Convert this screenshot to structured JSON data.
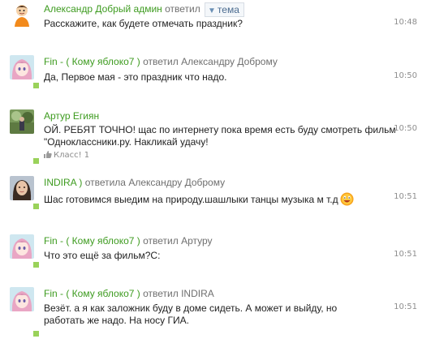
{
  "colors": {
    "author": "#3d9b1f",
    "online": "#9ad25a"
  },
  "tema_button": {
    "label": "тема",
    "icon": "triangle-down-icon"
  },
  "messages": [
    {
      "author": "Александр Добрый админ",
      "reply_prefix": "ответил",
      "reply_to": "",
      "text": "Расскажите, как будете отмечать праздник?",
      "time": "10:48",
      "avatar": "cartoon-avatar-icon",
      "online": false,
      "likes": ""
    },
    {
      "author": "Fin - ( Кому яблоко7 )",
      "reply_prefix": "ответил",
      "reply_to": "Александру Доброму",
      "text": "Да, Первое мая - это праздник что надо.",
      "time": "10:50",
      "avatar": "anime-avatar-icon",
      "online": true,
      "likes": ""
    },
    {
      "author": "Артур Егиян",
      "reply_prefix": "",
      "reply_to": "",
      "text": "ОЙ. РЕБЯТ ТОЧНО! щас по интернету пока время есть буду смотреть фильм \"Одноклассники.ру. Накликай удачу!",
      "time": "10:50",
      "avatar": "photo-avatar-icon",
      "online": true,
      "likes": "Класс! 1"
    },
    {
      "author": "INDIRA )",
      "reply_prefix": "ответила",
      "reply_to": "Александру Доброму",
      "text": "Шас готовимся выедим на природу.шашлыки танцы музыка м т.д",
      "time": "10:51",
      "avatar": "woman-avatar-icon",
      "online": true,
      "likes": ""
    },
    {
      "author": "Fin - ( Кому яблоко7 )",
      "reply_prefix": "ответил",
      "reply_to": "Артуру",
      "text": "Что это ещё за фильм?С:",
      "time": "10:51",
      "avatar": "anime-avatar-icon",
      "online": true,
      "likes": ""
    },
    {
      "author": "Fin - ( Кому яблоко7 )",
      "reply_prefix": "ответил",
      "reply_to": "INDIRA",
      "text": "Везёт. а я как заложник буду в доме сидеть. А может и выйду, но работать же надо. На носу ГИА.",
      "time": "10:51",
      "avatar": "anime-avatar-icon",
      "online": true,
      "likes": ""
    }
  ]
}
